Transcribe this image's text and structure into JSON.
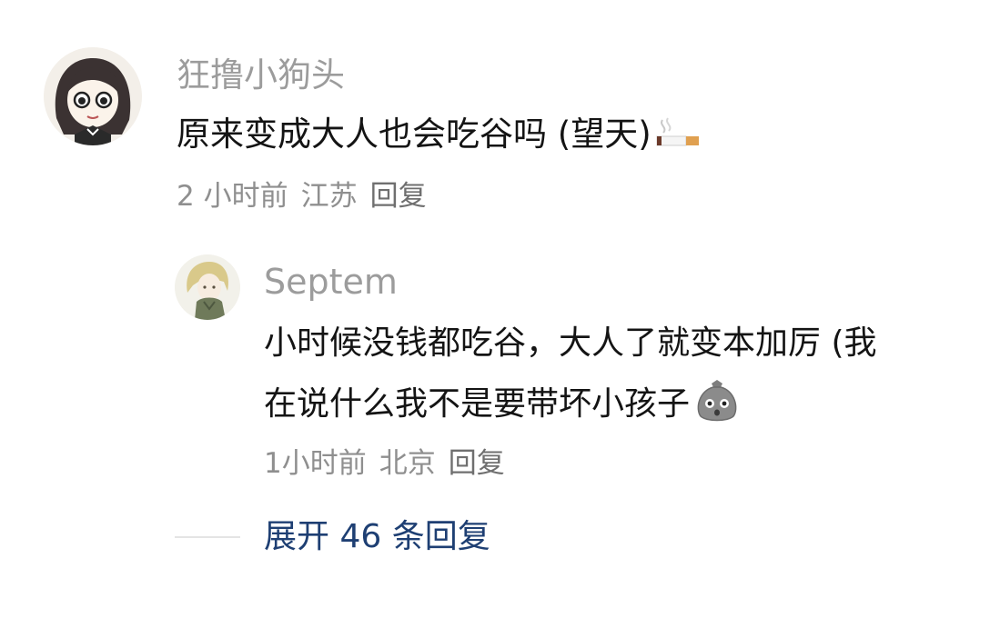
{
  "comments": [
    {
      "username": "狂撸小狗头",
      "text": "原来变成大人也会吃谷吗 (望天)",
      "emoji": "cigarette-emoji",
      "time": "2 小时前",
      "location": "江苏",
      "reply_label": "回复"
    },
    {
      "username": "Septem",
      "text_line1": "小时候没钱都吃谷，大人了就变本加厉 (我",
      "text_line2": "在说什么我不是要带坏小孩子",
      "emoji": "grey-bag-face-emoji",
      "time": "1小时前",
      "location": "北京",
      "reply_label": "回复"
    }
  ],
  "expand_replies": "展开 46 条回复",
  "colors": {
    "username": "#9c9c9c",
    "content": "#141414",
    "meta": "#8f8f8f",
    "expand_link": "#1e3f73"
  }
}
